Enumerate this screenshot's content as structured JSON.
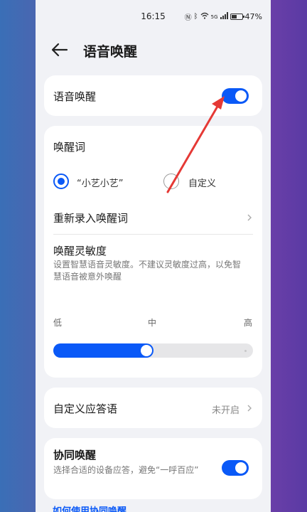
{
  "status_bar": {
    "time": "16:15",
    "battery_percent": "47%",
    "signal_text": "5G"
  },
  "header": {
    "title": "语音唤醒"
  },
  "voice_wake": {
    "label": "语音唤醒",
    "enabled": true
  },
  "wake_word": {
    "section_title": "唤醒词",
    "options": [
      {
        "label": "“小艺小艺”",
        "selected": true
      },
      {
        "label": "自定义",
        "selected": false
      }
    ],
    "rerecord_label": "重新录入唤醒词"
  },
  "sensitivity": {
    "title": "唤醒灵敏度",
    "description": "设置智慧语音灵敏度。不建议灵敏度过高，以免智慧语音被意外唤醒",
    "ticks": [
      "低",
      "中",
      "高"
    ],
    "value_fraction": 0.5
  },
  "custom_reply": {
    "label": "自定义应答语",
    "value": "未开启"
  },
  "collab_wake": {
    "label": "协同唤醒",
    "description": "选择合适的设备应答，避免“一呼百应”",
    "enabled": true
  },
  "help_link": {
    "label": "如何使用协同唤醒"
  },
  "colors": {
    "accent": "#0a59f7",
    "annotation_arrow": "#e53935"
  }
}
